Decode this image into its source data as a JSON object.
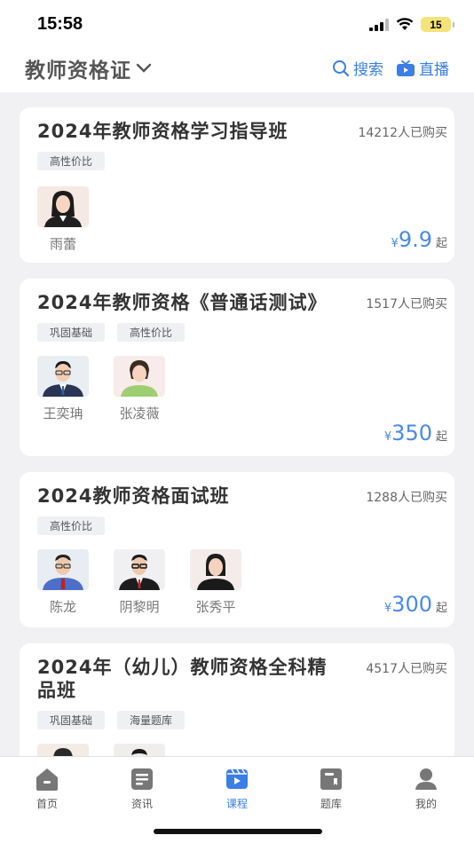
{
  "status_bar": {
    "time": "15:58",
    "battery": "15"
  },
  "header": {
    "title": "教师资格证",
    "search_label": "搜索",
    "live_label": "直播",
    "accent": "#3a7ee6"
  },
  "courses": [
    {
      "title": "2024年教师资格学习指导班",
      "sold": "14212人已购买",
      "tags": [
        "高性价比"
      ],
      "teachers": [
        "雨蕾"
      ],
      "price_symbol": "¥",
      "price": "9.9",
      "price_suffix": "起"
    },
    {
      "title": "2024年教师资格《普通话测试》",
      "sold": "1517人已购买",
      "tags": [
        "巩固基础",
        "高性价比"
      ],
      "teachers": [
        "王奕珃",
        "张凌薇"
      ],
      "price_symbol": "¥",
      "price": "350",
      "price_suffix": "起"
    },
    {
      "title": "2024教师资格面试班",
      "sold": "1288人已购买",
      "tags": [
        "高性价比"
      ],
      "teachers": [
        "陈龙",
        "阴黎明",
        "张秀平"
      ],
      "price_symbol": "¥",
      "price": "300",
      "price_suffix": "起"
    },
    {
      "title": "2024年（幼儿）教师资格全科精品班",
      "sold": "4517人已购买",
      "tags": [
        "巩固基础",
        "海量题库"
      ],
      "teachers": []
    }
  ],
  "tabbar": {
    "items": [
      {
        "label": "首页",
        "icon": "home-icon"
      },
      {
        "label": "资讯",
        "icon": "news-icon"
      },
      {
        "label": "课程",
        "icon": "course-icon",
        "active": true
      },
      {
        "label": "题库",
        "icon": "question-bank-icon"
      },
      {
        "label": "我的",
        "icon": "profile-icon"
      }
    ]
  }
}
